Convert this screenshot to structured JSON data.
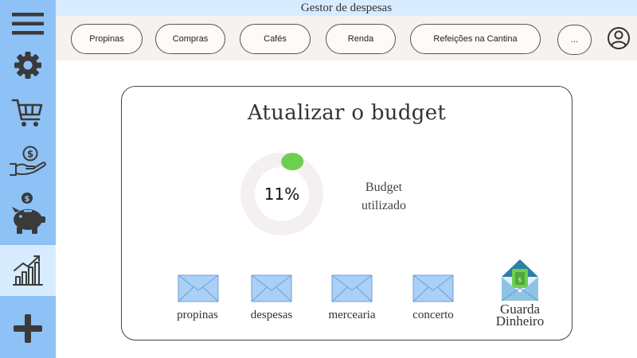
{
  "app": {
    "title": "Gestor de despesas"
  },
  "sidebar": {
    "items": [
      {
        "icon": "menu-icon"
      },
      {
        "icon": "gear-icon"
      },
      {
        "icon": "shopping-cart-icon"
      },
      {
        "icon": "hand-money-icon"
      },
      {
        "icon": "piggy-bank-icon"
      },
      {
        "icon": "growth-chart-icon",
        "active": true
      },
      {
        "icon": "plus-icon"
      }
    ]
  },
  "categories": [
    "Propinas",
    "Compras",
    "Cafés",
    "Renda",
    "Refeições na Cantina",
    "..."
  ],
  "budget": {
    "title": "Atualizar o budget",
    "percent_label": "11%",
    "used_fraction": 0.11,
    "label_line1": "Budget",
    "label_line2": "utilizado"
  },
  "envelopes": [
    "propinas",
    "despesas",
    "mercearia",
    "concerto"
  ],
  "logo": {
    "line1": "Guarda",
    "line2": "Dinheiro"
  },
  "colors": {
    "sidebar": "#8ec1f6",
    "sidebar_active": "#d7ecff",
    "icon_dark": "#3a3a3a",
    "envelope": "#aad0f7",
    "progress": "#6dcf52",
    "track": "#f3f0ef"
  }
}
